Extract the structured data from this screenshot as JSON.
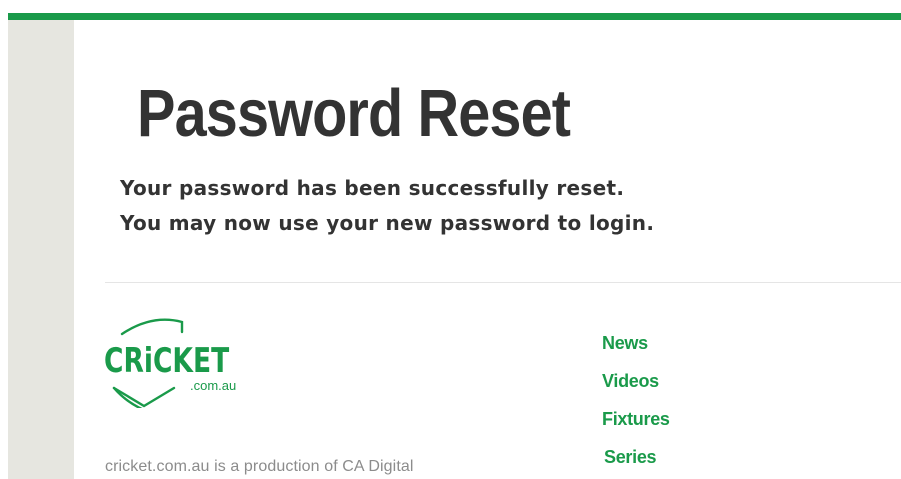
{
  "page": {
    "title": "Password Reset",
    "message_lines": [
      "Your password has been successfully reset.",
      "You may now use your new password to login."
    ]
  },
  "brand": {
    "logo_main": "CRiCKET",
    "logo_sub": ".com.au",
    "accent_color": "#1a9a4a"
  },
  "footer": {
    "nav": [
      "News",
      "Videos",
      "Fixtures",
      "Series"
    ],
    "production_text": "cricket.com.au is a production of CA Digital"
  }
}
